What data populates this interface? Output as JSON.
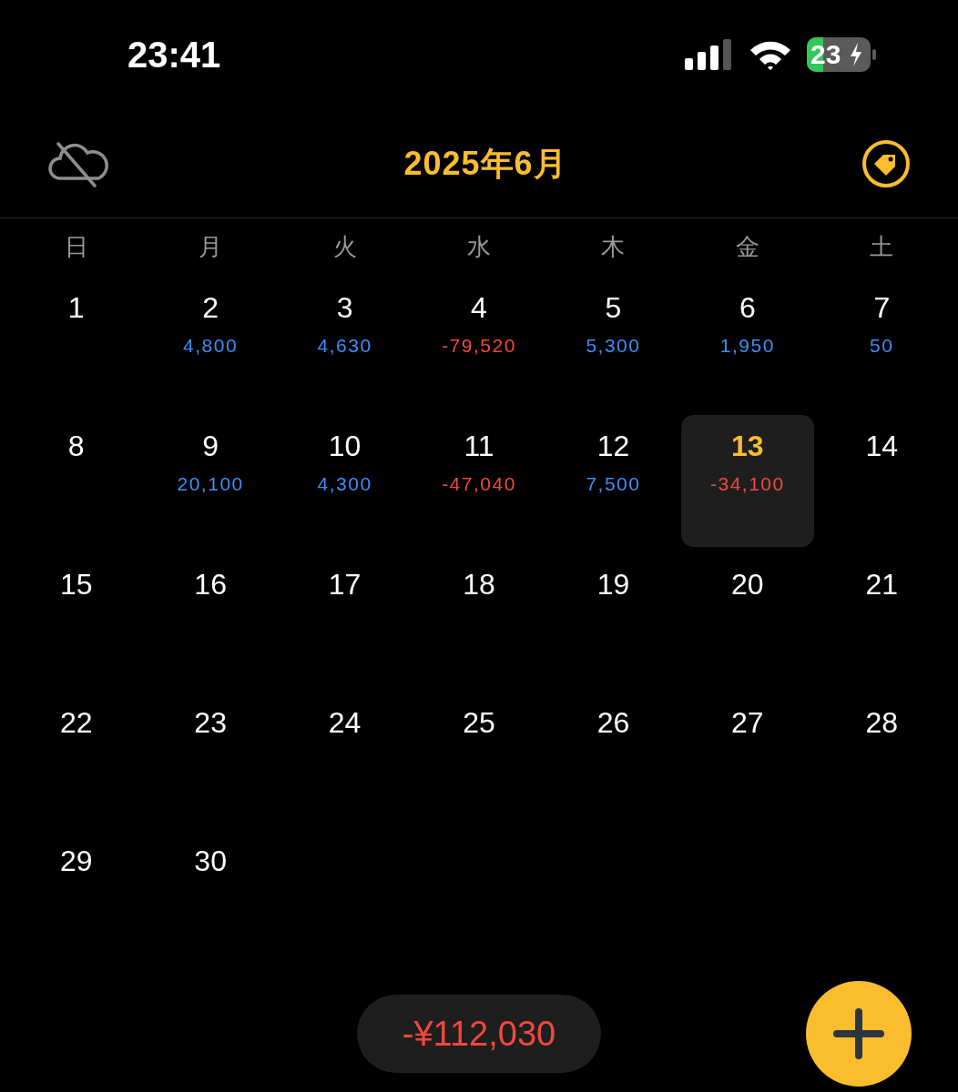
{
  "status_bar": {
    "time": "23:41",
    "battery": "23"
  },
  "header": {
    "title": "2025年6月"
  },
  "weekdays": [
    "日",
    "月",
    "火",
    "水",
    "木",
    "金",
    "土"
  ],
  "days": [
    {
      "day": "1",
      "selected": false
    },
    {
      "day": "2",
      "selected": false,
      "amount": {
        "text": "4,800",
        "kind": "income"
      }
    },
    {
      "day": "3",
      "selected": false,
      "amount": {
        "text": "4,630",
        "kind": "income"
      }
    },
    {
      "day": "4",
      "selected": false,
      "amount": {
        "text": "-79,520",
        "kind": "expense"
      }
    },
    {
      "day": "5",
      "selected": false,
      "amount": {
        "text": "5,300",
        "kind": "income"
      }
    },
    {
      "day": "6",
      "selected": false,
      "amount": {
        "text": "1,950",
        "kind": "income"
      }
    },
    {
      "day": "7",
      "selected": false,
      "amount": {
        "text": "50",
        "kind": "income"
      }
    },
    {
      "day": "8",
      "selected": false
    },
    {
      "day": "9",
      "selected": false,
      "amount": {
        "text": "20,100",
        "kind": "income"
      }
    },
    {
      "day": "10",
      "selected": false,
      "amount": {
        "text": "4,300",
        "kind": "income"
      }
    },
    {
      "day": "11",
      "selected": false,
      "amount": {
        "text": "-47,040",
        "kind": "expense"
      }
    },
    {
      "day": "12",
      "selected": false,
      "amount": {
        "text": "7,500",
        "kind": "income"
      }
    },
    {
      "day": "13",
      "selected": true,
      "amount": {
        "text": "-34,100",
        "kind": "expense"
      }
    },
    {
      "day": "14",
      "selected": false
    },
    {
      "day": "15",
      "selected": false
    },
    {
      "day": "16",
      "selected": false
    },
    {
      "day": "17",
      "selected": false
    },
    {
      "day": "18",
      "selected": false
    },
    {
      "day": "19",
      "selected": false
    },
    {
      "day": "20",
      "selected": false
    },
    {
      "day": "21",
      "selected": false
    },
    {
      "day": "22",
      "selected": false
    },
    {
      "day": "23",
      "selected": false
    },
    {
      "day": "24",
      "selected": false
    },
    {
      "day": "25",
      "selected": false
    },
    {
      "day": "26",
      "selected": false
    },
    {
      "day": "27",
      "selected": false
    },
    {
      "day": "28",
      "selected": false
    },
    {
      "day": "29",
      "selected": false
    },
    {
      "day": "30",
      "selected": false
    }
  ],
  "total": {
    "text": "-¥112,030",
    "kind": "expense"
  }
}
